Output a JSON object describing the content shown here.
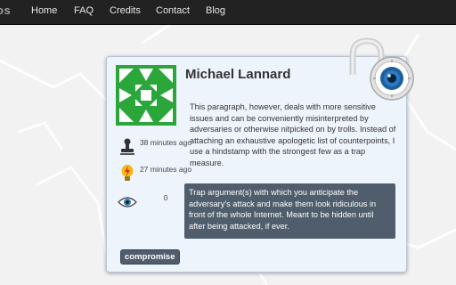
{
  "nav": {
    "brand": "os",
    "links": [
      "Home",
      "FAQ",
      "Credits",
      "Contact",
      "Blog"
    ]
  },
  "colors": {
    "navbar_bg": "#222222",
    "avatar_green": "#2aa63b",
    "trap_box_bg": "#4f5d6c",
    "card_bg": "#eef4fc"
  },
  "card": {
    "name": "Michael Lannard",
    "avatar_icon": "identicon-avatar",
    "meta": [
      {
        "icon": "stamp-icon",
        "text": "38 minutes ago"
      },
      {
        "icon": "lightning-bulb-icon",
        "text": "27 minutes ago"
      },
      {
        "icon": "eye-icon",
        "text": "0"
      }
    ],
    "paragraph": "This paragraph, however, deals with more sensitive issues and can be conveniently misinterpreted by adversaries or otherwise nitpicked on by trolls. Instead of attaching an exhaustive apologetic list of counterpoints, I use a hindstamp with the strongest few as a trap measure.",
    "trap_text": "Trap argument(s) with which you anticipate the adversary's attack and make them look ridiculous in front of the whole Internet. Meant to be hidden until after being attacked, if ever.",
    "button_label": "compromise",
    "lock_icon": "open-padlock-icon"
  }
}
